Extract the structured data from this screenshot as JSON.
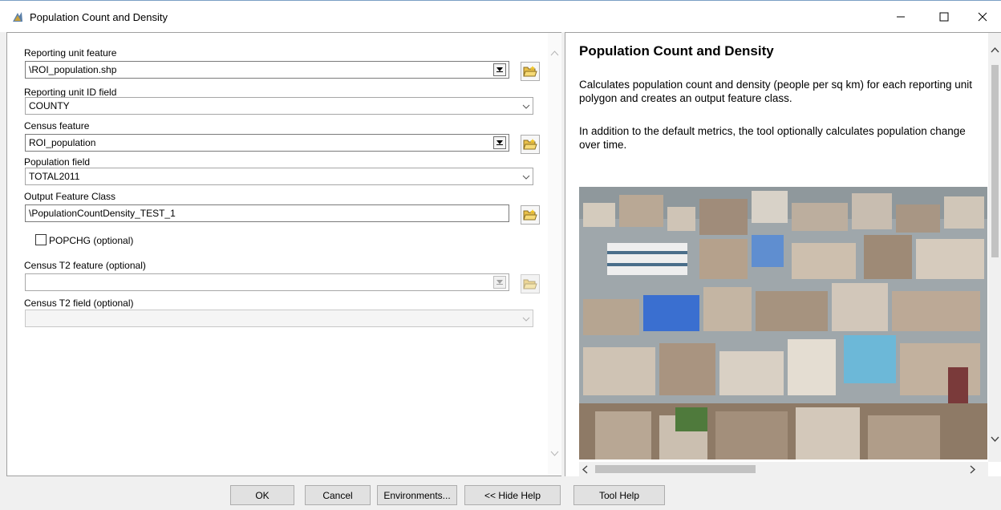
{
  "window": {
    "title": "Population Count and Density"
  },
  "form": {
    "reporting_unit_feature": {
      "label": "Reporting unit feature",
      "value": "\\ROI_population.shp"
    },
    "reporting_unit_id_field": {
      "label": "Reporting unit ID field",
      "value": "COUNTY"
    },
    "census_feature": {
      "label": "Census feature",
      "value": "ROI_population"
    },
    "population_field": {
      "label": "Population field",
      "value": "TOTAL2011"
    },
    "output_feature_class": {
      "label": "Output Feature Class",
      "value": "\\PopulationCountDensity_TEST_1"
    },
    "popchg": {
      "label": "POPCHG (optional)",
      "checked": false
    },
    "census_t2_feature": {
      "label": "Census T2 feature (optional)",
      "value": ""
    },
    "census_t2_field": {
      "label": "Census T2 field (optional)",
      "value": ""
    }
  },
  "help": {
    "title": "Population Count and Density",
    "para1": "Calculates population count and density (people per sq km) for each reporting unit polygon and creates an output feature class.",
    "para2": "In addition to the default metrics, the tool optionally calculates population change over time."
  },
  "buttons": {
    "ok": "OK",
    "cancel": "Cancel",
    "environments": "Environments...",
    "hide_help": "<< Hide Help",
    "tool_help": "Tool Help"
  },
  "icons": {
    "app": "arcgis-tool-icon",
    "browse": "folder-open-icon",
    "minimize": "minimize-icon",
    "maximize": "maximize-icon",
    "close": "close-icon"
  },
  "colors": {
    "folder": "#e8c04a",
    "border": "#a0a0a0",
    "button_face": "#e1e1e1"
  }
}
